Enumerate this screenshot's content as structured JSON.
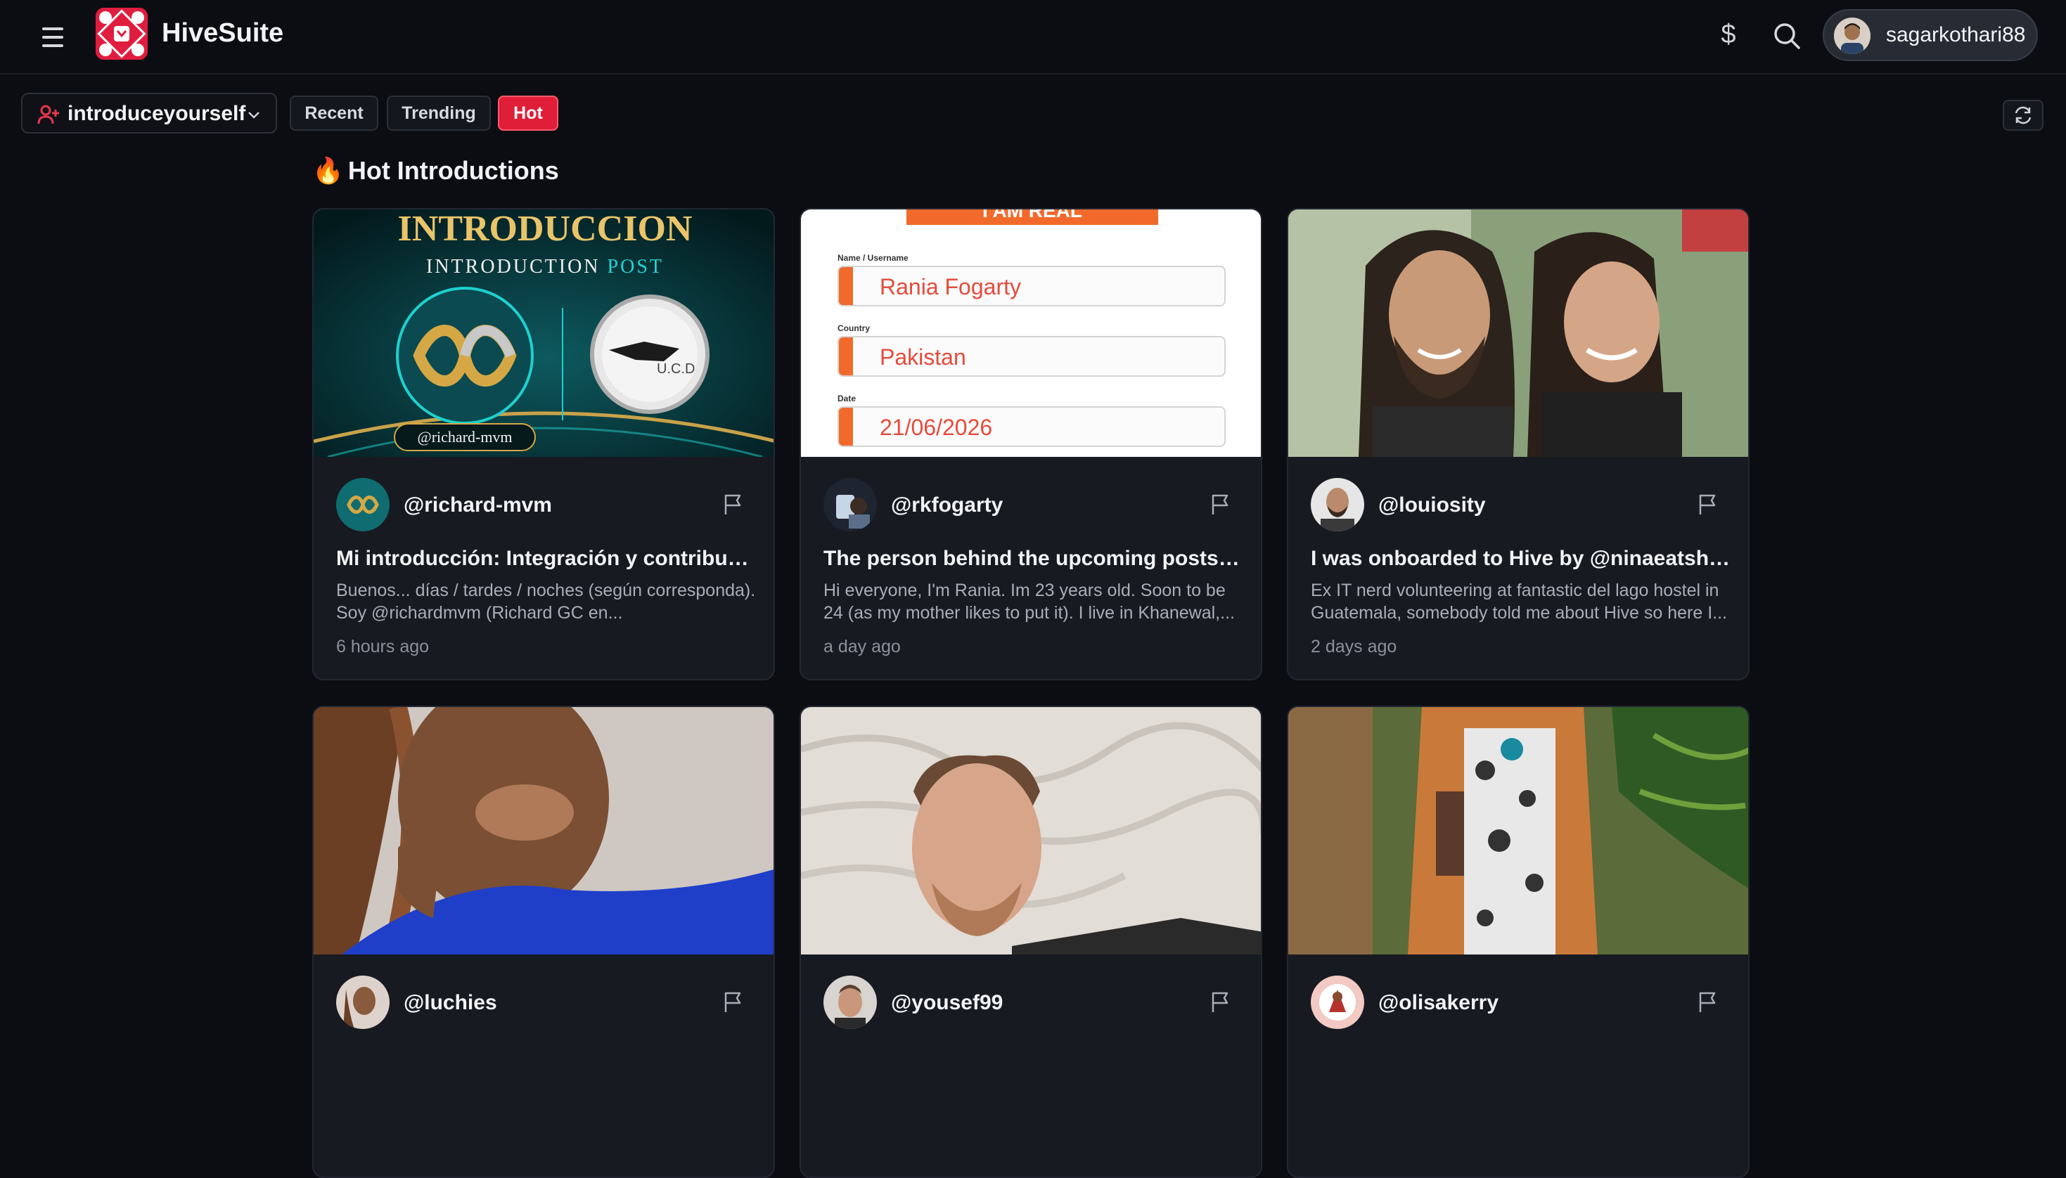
{
  "header": {
    "brand": "HiveSuite",
    "currency_symbol": "$",
    "username": "sagarkothari88"
  },
  "toolbar": {
    "community": "introduceyourself",
    "tabs": [
      {
        "label": "Recent",
        "active": false
      },
      {
        "label": "Trending",
        "active": false
      },
      {
        "label": "Hot",
        "active": true
      }
    ]
  },
  "section": {
    "emoji": "🔥",
    "title": "Hot Introductions"
  },
  "posts": [
    {
      "author": "@richard-mvm",
      "title": "Mi introducción: Integración y contribució...",
      "excerpt": "Buenos... días / tardes / noches (según corresponda). Soy @richardmvm (Richard GC en...",
      "time": "6 hours ago",
      "thumb_text": {
        "heading": "INTRODUCCION",
        "sub1": "INTRODUCTION",
        "sub2": "POST",
        "handle": "@richard-mvm",
        "coin": "U.C.D"
      }
    },
    {
      "author": "@rkfogarty",
      "title": "The person behind the upcoming posts -...",
      "excerpt": "Hi everyone, I'm Rania. Im 23 years old. Soon to be 24 (as my mother likes to put it). I live in Khanewal,...",
      "time": "a day ago",
      "thumb_text": {
        "banner": "I AM REAL",
        "label_name": "Name / Username",
        "name": "Rania Fogarty",
        "label_country": "Country",
        "country": "Pakistan",
        "label_date": "Date",
        "date": "21/06/2026"
      }
    },
    {
      "author": "@louiosity",
      "title": "I was onboarded to Hive by @ninaeatshere",
      "excerpt": "Ex IT nerd volunteering at fantastic del lago hostel in Guatemala, somebody told me about Hive so here I...",
      "time": "2 days ago"
    },
    {
      "author": "@luchies"
    },
    {
      "author": "@yousef99"
    },
    {
      "author": "@olisakerry"
    }
  ],
  "colors": {
    "background": "#0b0d12",
    "card": "#171a21",
    "accent": "#e01e37",
    "muted_text": "#a9adb8"
  },
  "icons": [
    "menu-icon",
    "hive-logo",
    "dollar-icon",
    "search-icon",
    "user-add-icon",
    "chevron-down-icon",
    "refresh-icon",
    "flag-icon"
  ]
}
